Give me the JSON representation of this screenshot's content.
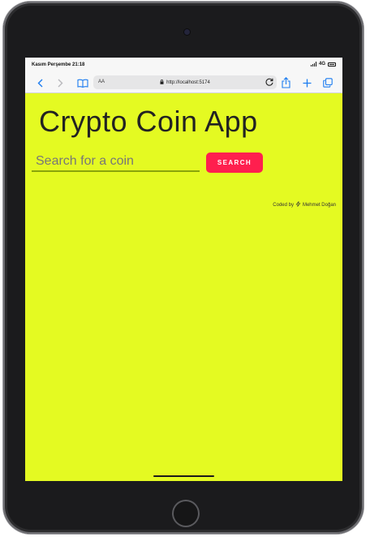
{
  "status_bar": {
    "time": "Kasım Perşembe 21:18",
    "network": "4G"
  },
  "browser": {
    "text_size_label": "AA",
    "url": "http://localhost:5174",
    "icons": [
      "chevron-left-icon",
      "chevron-right-icon",
      "book-icon",
      "lock-icon",
      "reload-icon",
      "share-icon",
      "plus-icon",
      "tabs-icon"
    ]
  },
  "app": {
    "title": "Crypto Coin App",
    "search": {
      "placeholder": "Search for a coin",
      "value": "",
      "button_label": "SEARCH"
    },
    "credit": {
      "prefix": "Coded by",
      "author": "Mehmet Doğan"
    }
  },
  "colors": {
    "page_background": "#e4fa22",
    "search_button": "#ff1f4e",
    "browser_accent": "#1c7cf0"
  }
}
